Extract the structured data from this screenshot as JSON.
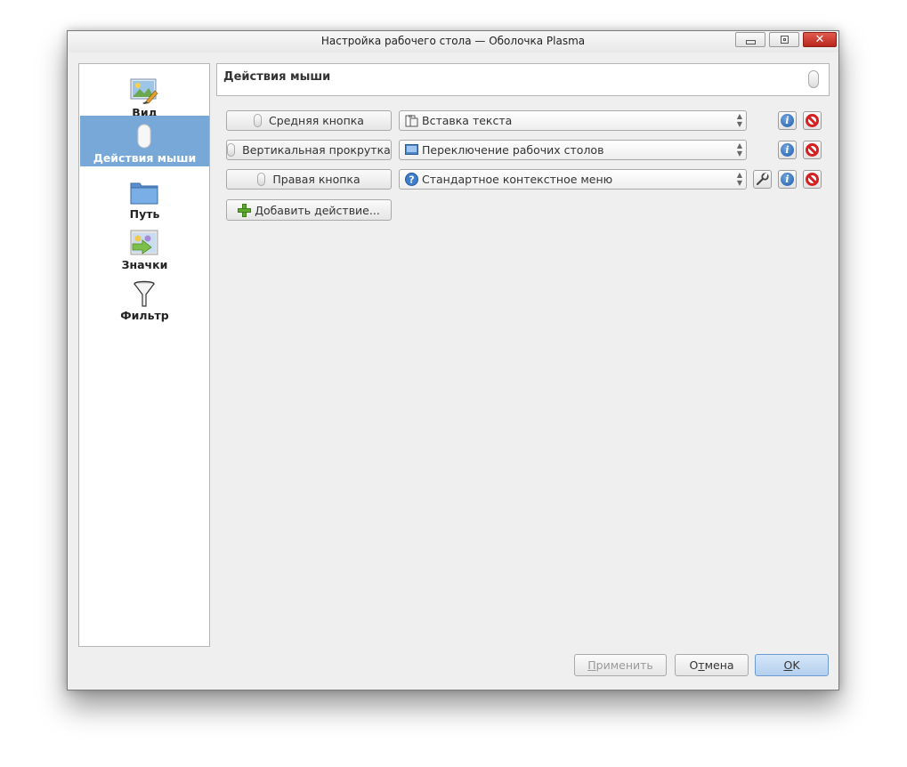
{
  "window": {
    "title": "Настройка рабочего стола — Оболочка Plasma",
    "close_glyph": "✕"
  },
  "sidebar": {
    "items": [
      {
        "label": "Вид",
        "icon": "appearance-icon",
        "selected": false
      },
      {
        "label": "Действия мыши",
        "icon": "mouse-icon",
        "selected": true
      },
      {
        "label": "Путь",
        "icon": "folder-icon",
        "selected": false
      },
      {
        "label": "Значки",
        "icon": "icons-icon",
        "selected": false
      },
      {
        "label": "Фильтр",
        "icon": "filter-icon",
        "selected": false
      }
    ]
  },
  "page": {
    "title": "Действия мыши"
  },
  "actions": [
    {
      "trigger": "Средняя кнопка",
      "action": "Вставка текста",
      "action_icon": "paste-icon",
      "has_config": false
    },
    {
      "trigger": "Вертикальная прокрутка",
      "action": "Переключение рабочих столов",
      "action_icon": "desktop-icon",
      "has_config": false
    },
    {
      "trigger": "Правая кнопка",
      "action": "Стандартное контекстное меню",
      "action_icon": "question-icon",
      "has_config": true
    }
  ],
  "add_action_label": "Добавить действие...",
  "buttons": {
    "apply": {
      "before": "",
      "mnemonic": "П",
      "after": "рименить",
      "enabled": false
    },
    "cancel": {
      "before": "О",
      "mnemonic": "т",
      "after": "мена"
    },
    "ok": {
      "before": "",
      "mnemonic": "O",
      "after": "K"
    }
  },
  "colors": {
    "selection": "#78a8d7",
    "info": "#1e5aa8",
    "remove": "#d42020"
  }
}
